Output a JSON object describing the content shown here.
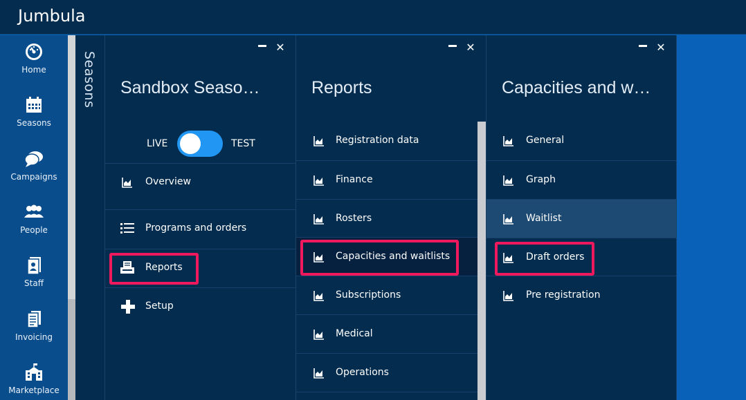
{
  "app": {
    "title": "Jumbula"
  },
  "nav": {
    "items": [
      {
        "label": "Home",
        "icon": "speedometer-icon"
      },
      {
        "label": "Seasons",
        "icon": "calendar-icon"
      },
      {
        "label": "Campaigns",
        "icon": "chat-bubbles-icon"
      },
      {
        "label": "People",
        "icon": "people-icon"
      },
      {
        "label": "Staff",
        "icon": "staff-badge-icon"
      },
      {
        "label": "Invoicing",
        "icon": "invoice-icon"
      },
      {
        "label": "Marketplace",
        "icon": "marketplace-building-icon"
      }
    ]
  },
  "seasons_rail": {
    "label": "Seasons"
  },
  "season_panel": {
    "title": "Sandbox Seaso…",
    "toggle": {
      "left": "LIVE",
      "right": "TEST"
    },
    "items": [
      {
        "label": "Overview",
        "icon": "chart-icon"
      },
      {
        "label": "Programs and orders",
        "icon": "list-icon"
      },
      {
        "label": "Reports",
        "icon": "report-printer-icon"
      },
      {
        "label": "Setup",
        "icon": "plus-icon"
      }
    ]
  },
  "reports_panel": {
    "title": "Reports",
    "items": [
      {
        "label": "Registration data"
      },
      {
        "label": "Finance"
      },
      {
        "label": "Rosters"
      },
      {
        "label": "Capacities and waitlists"
      },
      {
        "label": "Subscriptions"
      },
      {
        "label": "Medical"
      },
      {
        "label": "Operations"
      }
    ]
  },
  "capacities_panel": {
    "title": "Capacities and w…",
    "items": [
      {
        "label": "General"
      },
      {
        "label": "Graph"
      },
      {
        "label": "Waitlist"
      },
      {
        "label": "Draft orders"
      },
      {
        "label": "Pre registration"
      }
    ]
  },
  "colors": {
    "header_bg": "#032c4e",
    "nav_bg": "#0a4d8c",
    "accent": "#2196f3",
    "highlight_box": "#f0195d"
  }
}
